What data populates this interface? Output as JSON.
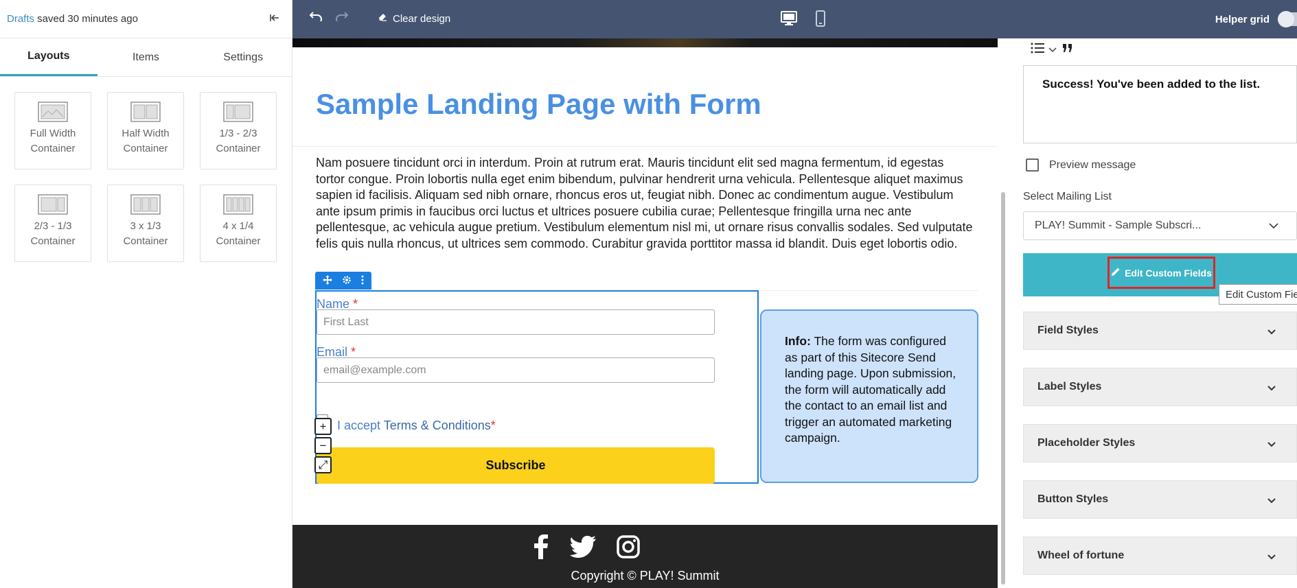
{
  "left_panel": {
    "drafts_label": "Drafts",
    "saved_status": " saved 30 minutes ago",
    "tabs": [
      {
        "label": "Layouts",
        "active": true
      },
      {
        "label": "Items",
        "active": false
      },
      {
        "label": "Settings",
        "active": false
      }
    ],
    "layouts": [
      {
        "line1": "Full Width",
        "line2": "Container",
        "icon": "full-width-container-icon"
      },
      {
        "line1": "Half Width",
        "line2": "Container",
        "icon": "half-width-container-icon"
      },
      {
        "line1": "1/3 - 2/3",
        "line2": "Container",
        "icon": "one-third-two-thirds-container-icon"
      },
      {
        "line1": "2/3 - 1/3",
        "line2": "Container",
        "icon": "two-thirds-one-third-container-icon"
      },
      {
        "line1": "3 x 1/3",
        "line2": "Container",
        "icon": "three-thirds-container-icon"
      },
      {
        "line1": "4 x 1/4",
        "line2": "Container",
        "icon": "four-quarters-container-icon"
      }
    ]
  },
  "topbar": {
    "clear_design": "Clear design",
    "helper_grid": "Helper grid",
    "helper_grid_on": false,
    "bg_color": "#455571"
  },
  "canvas": {
    "title": "Sample Landing Page with Form",
    "body": "Nam posuere tincidunt orci in interdum. Proin at rutrum erat. Mauris tincidunt elit sed magna fermentum, id egestas tortor congue. Proin lobortis nulla eget enim bibendum, pulvinar hendrerit urna vehicula. Pellentesque aliquet maximus sapien id facilisis. Aliquam sed nibh ornare, rhoncus eros ut, feugiat nibh. Donec ac condimentum augue. Vestibulum ante ipsum primis in faucibus orci luctus et ultrices posuere cubilia curae; Pellentesque fringilla urna nec ante pellentesque, ac vehicula augue pretium. Vestibulum elementum nisl mi, ut ornare risus convallis sodales. Sed vulputate felis quis nulla rhoncus, ut ultrices sem commodo. Curabitur gravida porttitor massa id blandit. Duis eget lobortis odio.",
    "form": {
      "name_label": "Name",
      "name_placeholder": "First Last",
      "email_label": "Email",
      "email_placeholder": "email@example.com",
      "required_mark": "*",
      "accept_text": "I accept ",
      "terms_text": "Terms & Conditions",
      "subscribe_label": "Subscribe"
    },
    "info": {
      "bold": "Info:",
      "text": " The form was configured as part of this Sitecore Send landing page. Upon submission, the form will automatically add the contact to an email list and trigger an automated marketing campaign."
    },
    "controls": {
      "plus": "+",
      "minus": "−",
      "expand": "⤢"
    },
    "footer": {
      "copyright": "Copyright © PLAY! Summit",
      "social": [
        "facebook-icon",
        "twitter-icon",
        "instagram-icon"
      ]
    }
  },
  "right_panel": {
    "success_message": "Success! You've been added to the list.",
    "preview_message": "Preview message",
    "select_mailing_list_label": "Select Mailing List",
    "mailing_list_value": "PLAY! Summit - Sample Subscri...",
    "edit_custom_fields": "Edit Custom Fields",
    "tooltip": "Edit Custom Fie",
    "accordions": [
      "Field Styles",
      "Label Styles",
      "Placeholder Styles",
      "Button Styles",
      "Wheel of fortune"
    ],
    "accent_color": "#3eb6c7"
  }
}
